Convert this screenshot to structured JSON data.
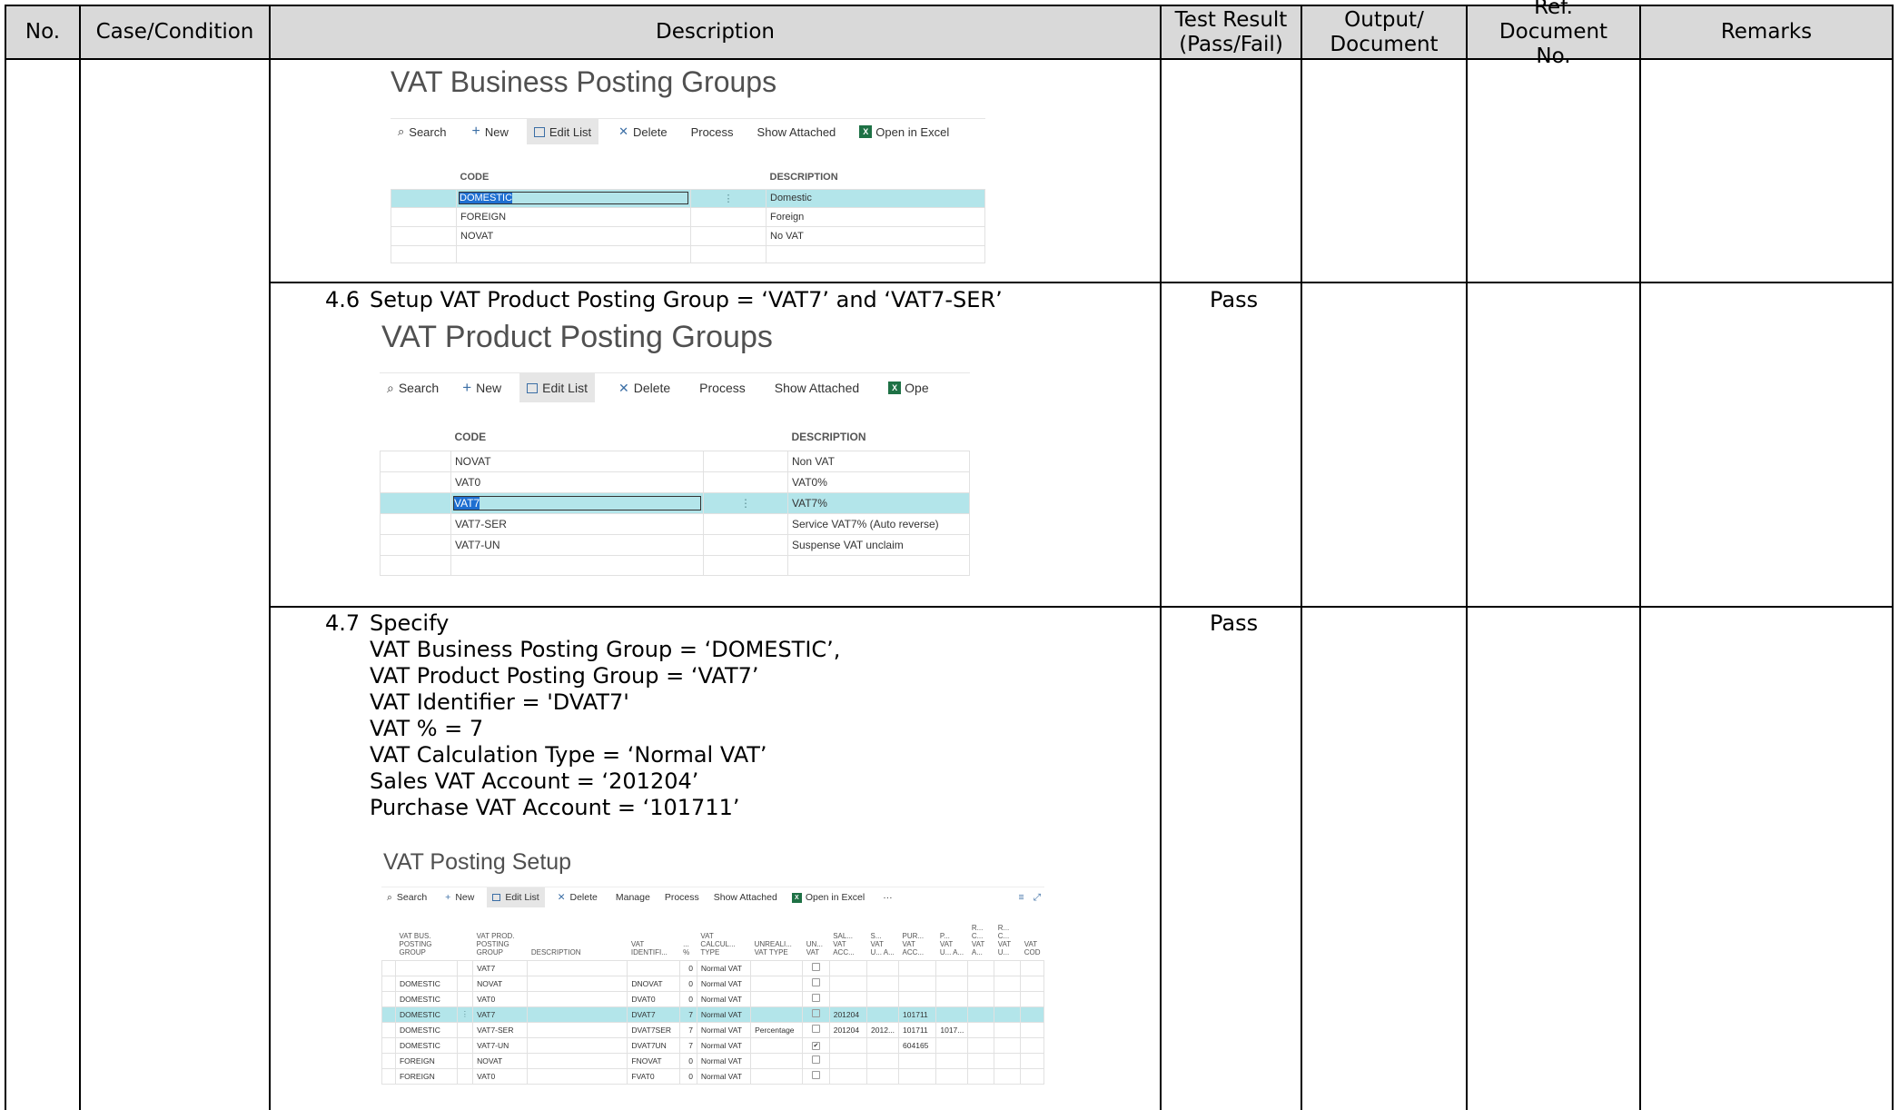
{
  "header": {
    "no": "No.",
    "case": "Case/Condition",
    "description": "Description",
    "result": "Test Result (Pass/Fail)",
    "output": "Output/ Document",
    "ref": "Ref. Document No.",
    "remarks": "Remarks"
  },
  "shot1": {
    "title": "VAT Business Posting Groups",
    "toolbar": [
      "Search",
      "New",
      "Edit List",
      "Delete",
      "Process",
      "Show Attached",
      "Open in Excel"
    ],
    "col_code": "CODE",
    "col_desc": "DESCRIPTION",
    "rows": [
      {
        "code": "DOMESTIC",
        "desc": "Domestic"
      },
      {
        "code": "FOREIGN",
        "desc": "Foreign"
      },
      {
        "code": "NOVAT",
        "desc": "No VAT"
      }
    ]
  },
  "step46": {
    "num": "4.6",
    "text": "Setup VAT Product Posting Group = ‘VAT7’ and ‘VAT7-SER’",
    "result": "Pass"
  },
  "shot2": {
    "title": "VAT Product Posting Groups",
    "toolbar": [
      "Search",
      "New",
      "Edit List",
      "Delete",
      "Process",
      "Show Attached",
      "Ope"
    ],
    "col_code": "CODE",
    "col_desc": "DESCRIPTION",
    "rows": [
      {
        "code": "NOVAT",
        "desc": "Non VAT"
      },
      {
        "code": "VAT0",
        "desc": "VAT0%"
      },
      {
        "code": "VAT7",
        "desc": "VAT7%"
      },
      {
        "code": "VAT7-SER",
        "desc": "Service VAT7% (Auto reverse)"
      },
      {
        "code": "VAT7-UN",
        "desc": "Suspense VAT unclaim"
      }
    ]
  },
  "step47": {
    "num": "4.7",
    "lines": [
      "Specify",
      "VAT Business Posting Group = ‘DOMESTIC’,",
      "VAT Product Posting Group = ‘VAT7’",
      "VAT Identifier = 'DVAT7'",
      "VAT % = 7",
      "VAT Calculation Type = ‘Normal VAT’",
      "Sales VAT Account = ‘201204’",
      "Purchase VAT Account = ‘101711’"
    ],
    "result": "Pass"
  },
  "shot3": {
    "title": "VAT Posting Setup",
    "toolbar": [
      "Search",
      "New",
      "Edit List",
      "Delete",
      "Manage",
      "Process",
      "Show Attached",
      "Open in Excel",
      "···"
    ],
    "columns": [
      "VAT BUS. POSTING GROUP",
      "VAT PROD. POSTING GROUP",
      "DESCRIPTION",
      "VAT IDENTIFI...",
      "... %",
      "VAT CALCUL... TYPE",
      "UNREALI... VAT TYPE",
      "UN... VAT",
      "SAL... VAT ACC...",
      "S... VAT U... A...",
      "PUR... VAT ACC...",
      "P... VAT U... A...",
      "R... C... VAT A...",
      "R... C... VAT U...",
      "VAT COD"
    ],
    "rows": [
      [
        "",
        "VAT7",
        "",
        "",
        "0",
        "Normal VAT",
        "",
        "",
        "",
        "",
        "",
        "",
        "",
        "",
        ""
      ],
      [
        "DOMESTIC",
        "NOVAT",
        "",
        "DNOVAT",
        "0",
        "Normal VAT",
        "",
        "",
        "",
        "",
        "",
        "",
        "",
        "",
        ""
      ],
      [
        "DOMESTIC",
        "VAT0",
        "",
        "DVAT0",
        "0",
        "Normal VAT",
        "",
        "",
        "",
        "",
        "",
        "",
        "",
        "",
        ""
      ],
      [
        "DOMESTIC",
        "VAT7",
        "",
        "DVAT7",
        "7",
        "Normal VAT",
        "",
        "",
        "201204",
        "",
        "101711",
        "",
        "",
        "",
        ""
      ],
      [
        "DOMESTIC",
        "VAT7-SER",
        "",
        "DVAT7SER",
        "7",
        "Normal VAT",
        "Percentage",
        "",
        "201204",
        "2012...",
        "101711",
        "1017...",
        "",
        "",
        ""
      ],
      [
        "DOMESTIC",
        "VAT7-UN",
        "",
        "DVAT7UN",
        "7",
        "Normal VAT",
        "",
        "✔",
        "",
        "",
        "604165",
        "",
        "",
        "",
        ""
      ],
      [
        "FOREIGN",
        "NOVAT",
        "",
        "FNOVAT",
        "0",
        "Normal VAT",
        "",
        "",
        "",
        "",
        "",
        "",
        "",
        "",
        ""
      ],
      [
        "FOREIGN",
        "VAT0",
        "",
        "FVAT0",
        "0",
        "Normal VAT",
        "",
        "",
        "",
        "",
        "",
        "",
        "",
        "",
        ""
      ]
    ]
  }
}
